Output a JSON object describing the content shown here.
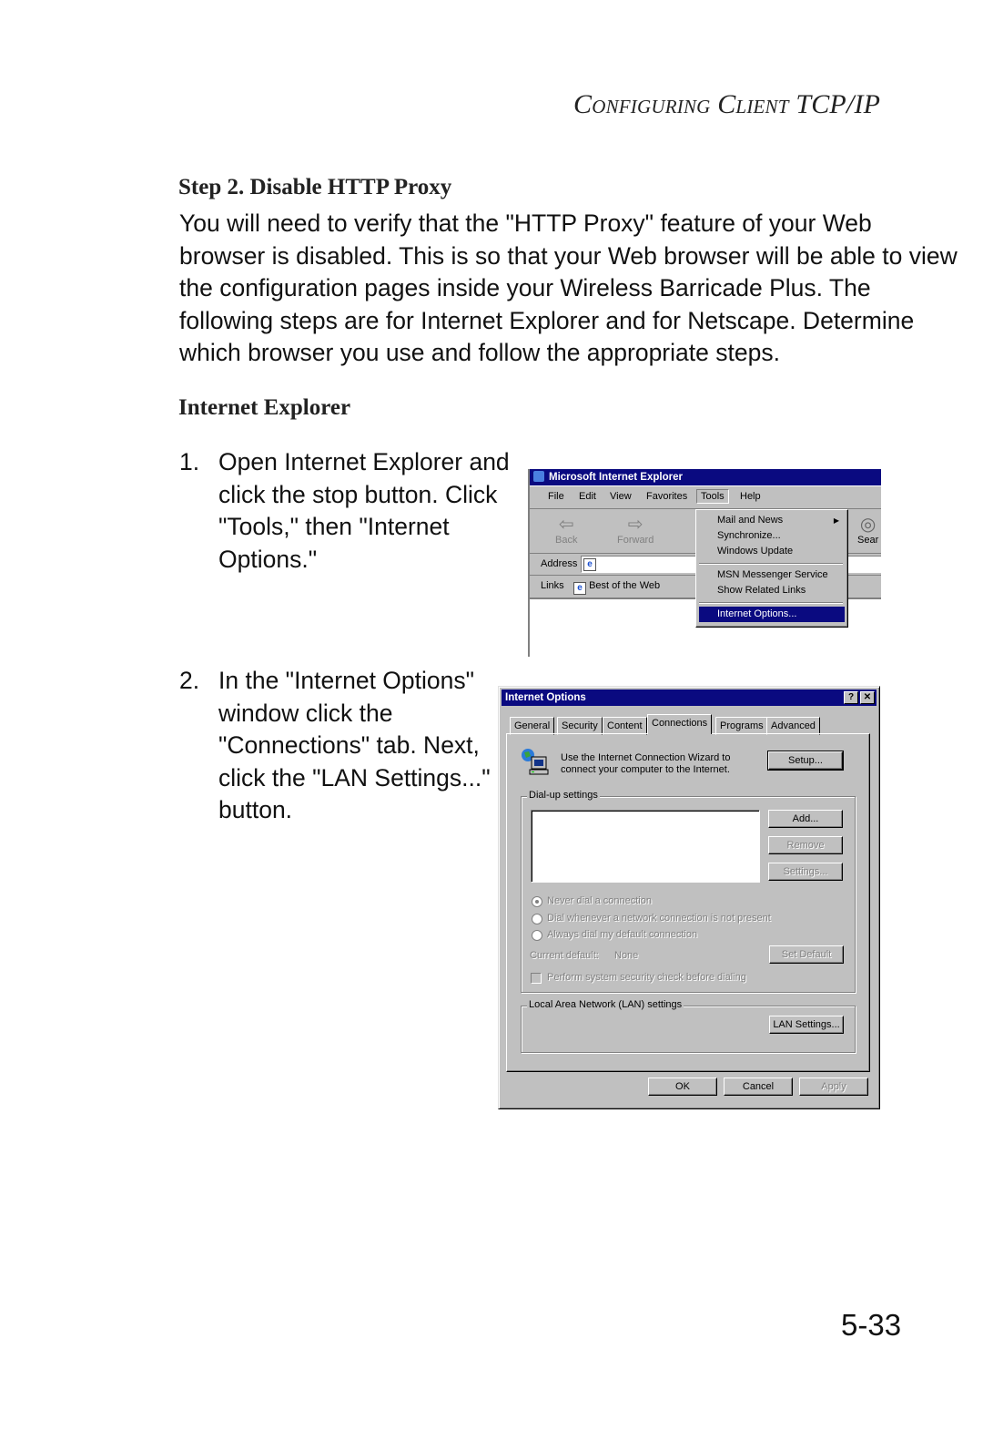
{
  "page": {
    "running_head": "Configuring Client TCP/IP",
    "section_heading": "Step 2. Disable HTTP Proxy",
    "intro": "You will need to verify that the \"HTTP Proxy\" feature of your Web browser is disabled. This is so that your Web browser will be able to view the configuration pages inside your Wireless Barricade Plus. The following steps are for Internet Explorer and for Netscape. Determine which browser you use and follow the appropriate steps.",
    "subheading": "Internet Explorer",
    "steps": [
      {
        "num": "1.",
        "text": "Open Internet Explorer and click the stop button. Click \"Tools,\" then \"Internet Options.\""
      },
      {
        "num": "2.",
        "text": "In the \"Internet Options\" window click the \"Connections\" tab. Next, click the \"LAN Settings...\" button."
      }
    ],
    "page_number": "5-33"
  },
  "ie_window": {
    "title": "Microsoft Internet Explorer",
    "menu": [
      "File",
      "Edit",
      "View",
      "Favorites",
      "Tools",
      "Help"
    ],
    "toolbar": {
      "back": "Back",
      "forward": "Forward",
      "search": "Sear"
    },
    "address_label": "Address",
    "links_label": "Links",
    "links": [
      "Best of the Web"
    ],
    "tools_menu": [
      {
        "label": "Mail and News",
        "submenu": true
      },
      {
        "label": "Synchronize..."
      },
      {
        "label": "Windows Update"
      },
      {
        "separator": true
      },
      {
        "label": "MSN Messenger Service"
      },
      {
        "label": "Show Related Links"
      },
      {
        "separator": true
      },
      {
        "label": "Internet Options...",
        "highlighted": true
      }
    ]
  },
  "internet_options": {
    "title": "Internet Options",
    "title_buttons": {
      "help": "?",
      "close": "✕"
    },
    "tabs": [
      "General",
      "Security",
      "Content",
      "Connections",
      "Programs",
      "Advanced"
    ],
    "active_tab": "Connections",
    "wizard_text_1": "Use the Internet Connection Wizard to",
    "wizard_text_2": "connect your computer to the Internet.",
    "setup_button": "Setup...",
    "dialup_group": "Dial-up settings",
    "add_button": "Add...",
    "remove_button": "Remove",
    "settings_button": "Settings...",
    "radio_options": [
      {
        "label": "Never dial a connection",
        "selected": true
      },
      {
        "label": "Dial whenever a network connection is not present",
        "selected": false
      },
      {
        "label": "Always dial my default connection",
        "selected": false
      }
    ],
    "current_default_label": "Current default:",
    "current_default_value": "None",
    "set_default_button": "Set Default",
    "security_check": "Perform system security check before dialing",
    "lan_group": "Local Area Network (LAN) settings",
    "lan_button": "LAN Settings...",
    "ok_button": "OK",
    "cancel_button": "Cancel",
    "apply_button": "Apply"
  }
}
